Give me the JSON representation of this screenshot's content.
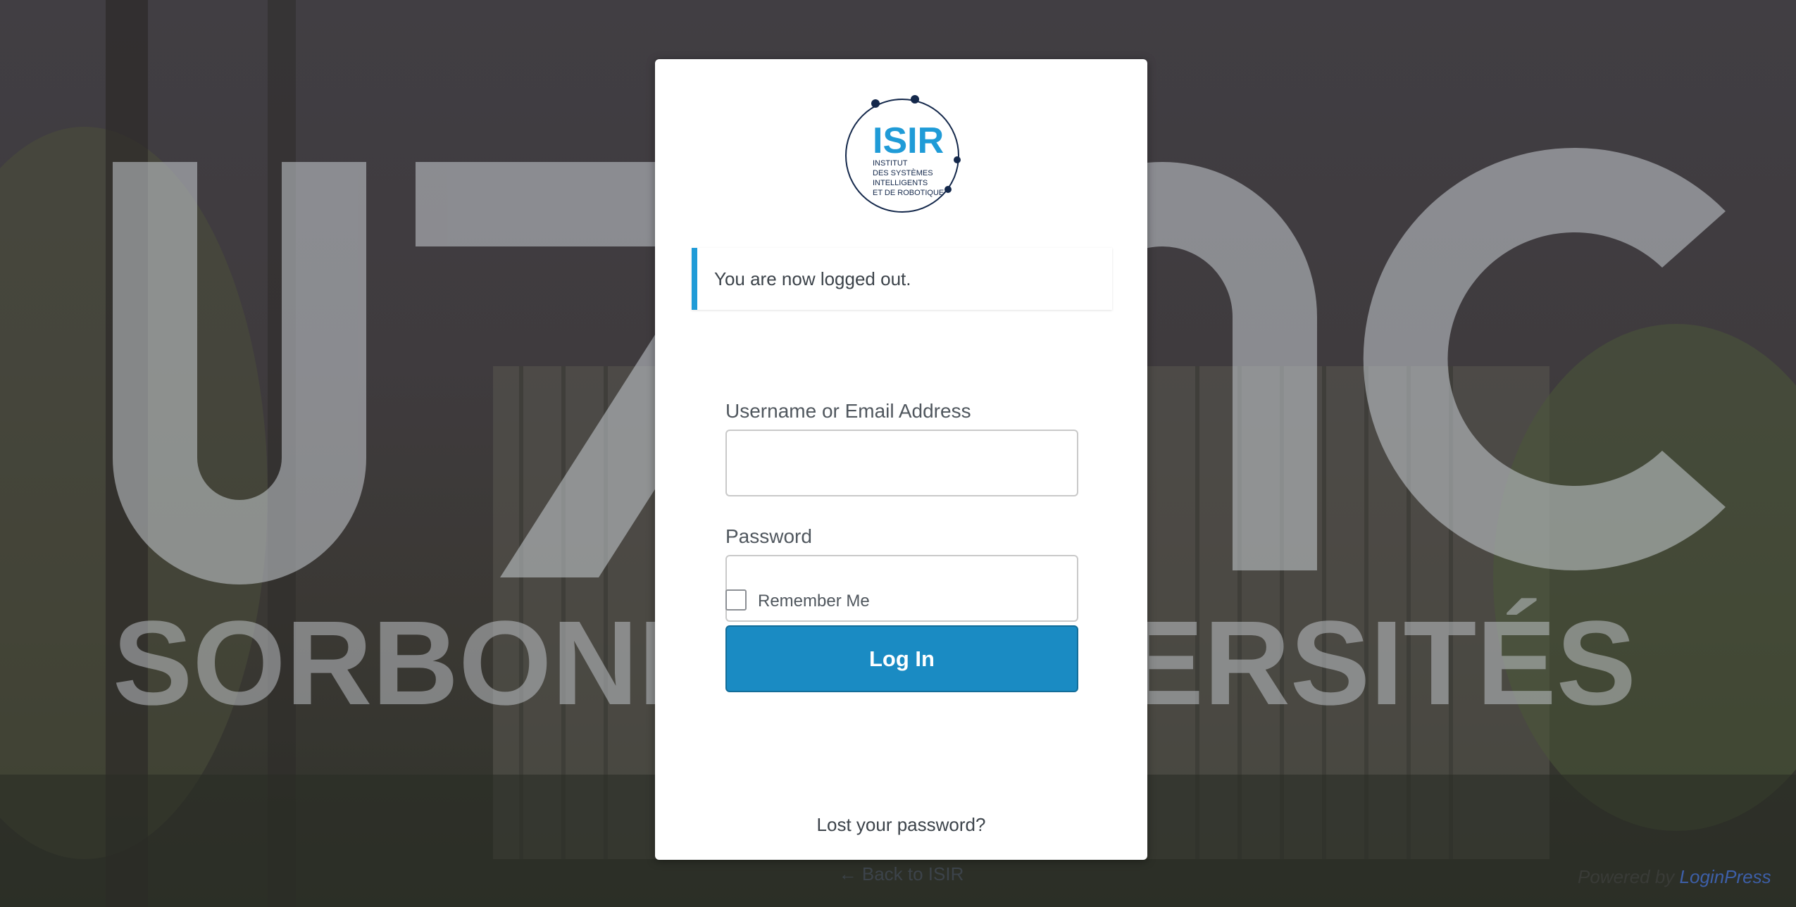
{
  "logo": {
    "wordmark": "ISIR",
    "lines": [
      "INSTITUT",
      "DES SYSTÈMES",
      "INTELLIGENTS",
      "ET DE ROBOTIQUE"
    ],
    "accent_color": "#1f9bd7",
    "dark_color": "#14284b"
  },
  "background": {
    "wordmark_big": "UPMC",
    "wordmark_sub": "SORBONNE UNIVERSITÉS",
    "tint_color": "#3f3c40"
  },
  "message": {
    "text": "You are now logged out.",
    "accent_color": "#1f9bd7"
  },
  "form": {
    "username_label": "Username or Email Address",
    "username_value": "",
    "password_label": "Password",
    "password_value": "",
    "remember_label": "Remember Me",
    "remember_checked": false,
    "submit_label": "Log In",
    "submit_color": "#1a8bc3"
  },
  "links": {
    "lost_password": "Lost your password?",
    "back_to_site": "← Back to ISIR"
  },
  "footer": {
    "prefix": "Powered by",
    "brand": "LoginPress"
  }
}
